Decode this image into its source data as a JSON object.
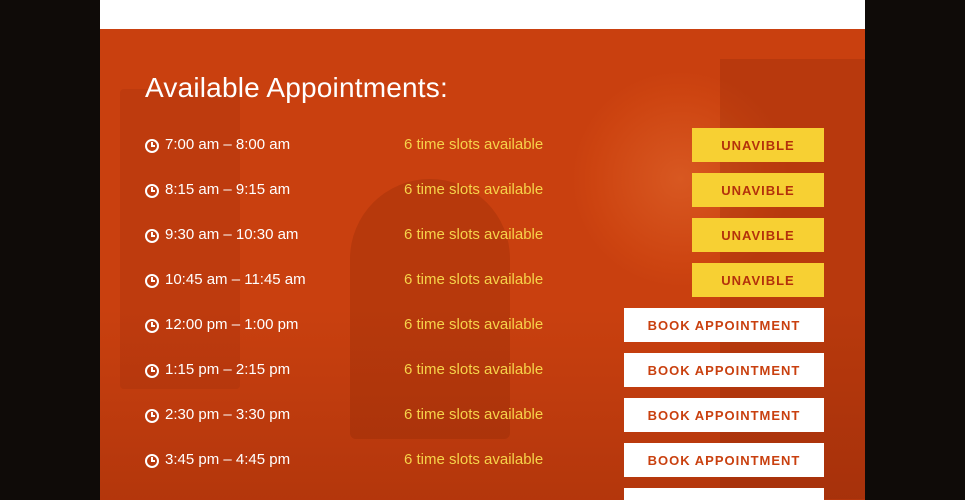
{
  "section": {
    "title": "Available Appointments:"
  },
  "appointments": [
    {
      "time": "7:00 am – 8:00 am",
      "slots": "6 time slots available",
      "button": "UNAVIBLE",
      "status": "unavailable"
    },
    {
      "time": "8:15 am – 9:15 am",
      "slots": "6 time slots available",
      "button": "UNAVIBLE",
      "status": "unavailable"
    },
    {
      "time": "9:30 am – 10:30 am",
      "slots": "6 time slots available",
      "button": "UNAVIBLE",
      "status": "unavailable"
    },
    {
      "time": "10:45 am – 11:45 am",
      "slots": "6 time slots available",
      "button": "UNAVIBLE",
      "status": "unavailable"
    },
    {
      "time": "12:00 pm – 1:00 pm",
      "slots": "6 time slots available",
      "button": "BOOK APPOINTMENT",
      "status": "available"
    },
    {
      "time": "1:15 pm – 2:15 pm",
      "slots": "6 time slots available",
      "button": "BOOK APPOINTMENT",
      "status": "available"
    },
    {
      "time": "2:30 pm – 3:30 pm",
      "slots": "6 time slots available",
      "button": "BOOK APPOINTMENT",
      "status": "available"
    },
    {
      "time": "3:45 pm – 4:45 pm",
      "slots": "6 time slots available",
      "button": "BOOK APPOINTMENT",
      "status": "available"
    },
    {
      "time": "",
      "slots": "",
      "button": "",
      "status": "available"
    }
  ],
  "icons": {
    "row_icon": "clock-icon"
  },
  "colors": {
    "panel": "#c9400f",
    "slots_text": "#f6d34a",
    "unavailable_button": "#f7d033",
    "book_button": "#ffffff"
  }
}
